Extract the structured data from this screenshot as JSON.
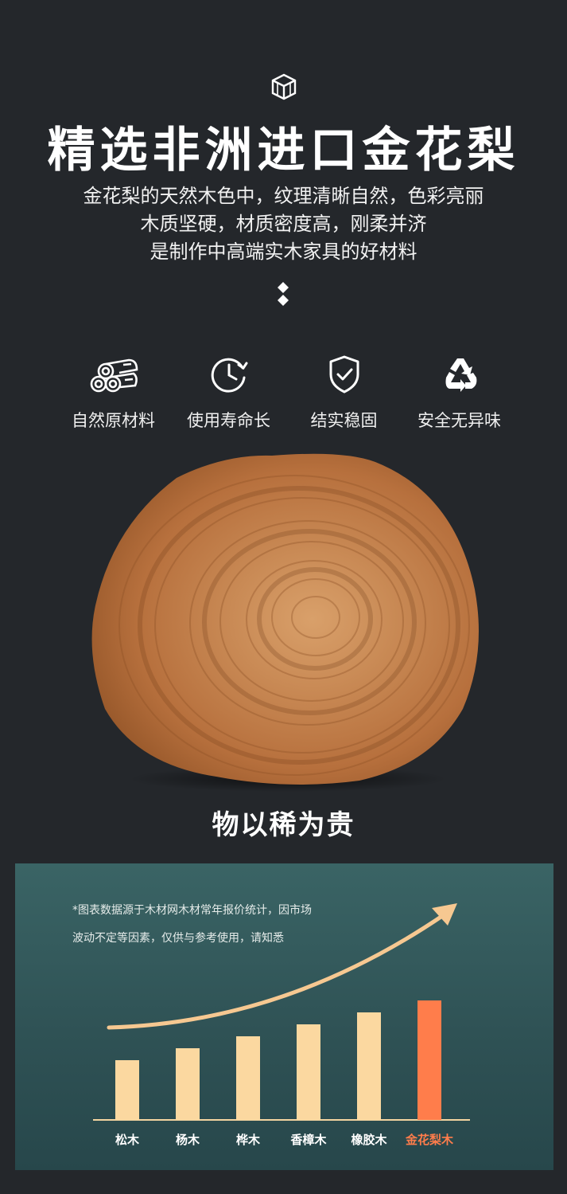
{
  "header": {
    "logo_icon": "wood-cube-icon",
    "title": "精选非洲进口金花梨",
    "description_lines": [
      "金花梨的天然木色中，纹理清晰自然，色彩亮丽",
      "木质坚硬，材质密度高，刚柔并济",
      "是制作中高端实木家具的好材料"
    ],
    "divider_icon": "double-diamond-icon"
  },
  "features": [
    {
      "icon": "logs-icon",
      "label": "自然原材料"
    },
    {
      "icon": "clock-icon",
      "label": "使用寿命长"
    },
    {
      "icon": "shield-check-icon",
      "label": "结实稳固"
    },
    {
      "icon": "recycle-icon",
      "label": "安全无异味"
    }
  ],
  "wood_image": {
    "icon": "wood-slice-image"
  },
  "subtitle": "物以稀为贵",
  "chart_note": {
    "line1": "*图表数据源于木材网木材常年报价统计，因市场",
    "line2": "波动不定等因素，仅供与参考使用，请知悉"
  },
  "chart_data": {
    "type": "bar",
    "categories": [
      "松木",
      "杨木",
      "桦木",
      "香樟木",
      "橡胶木",
      "金花梨木"
    ],
    "values": [
      1,
      1.2,
      1.4,
      1.6,
      1.8,
      2.0
    ],
    "ylim": [
      0,
      2.0
    ],
    "highlight_index": 5,
    "colors": {
      "bar": "#fbd8a0",
      "highlight": "#ff7d4b",
      "highlight_label": "#ff7d4b",
      "arrow": "#f6c891",
      "axis": "#f3d4a0"
    },
    "grid": false,
    "trend_arrow": true
  }
}
